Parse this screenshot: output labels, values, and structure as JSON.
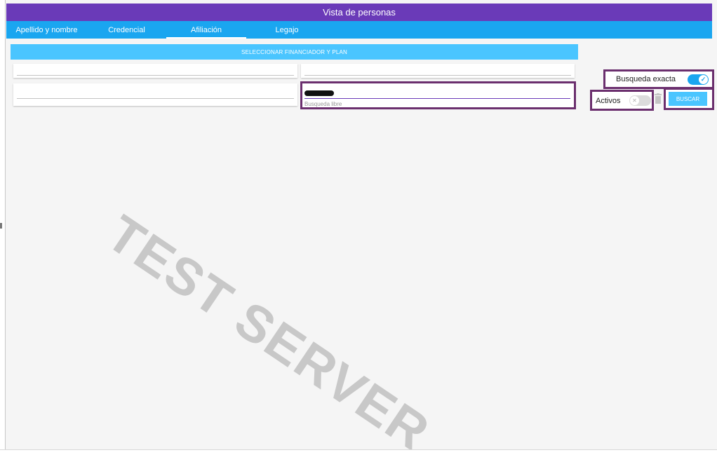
{
  "window": {
    "title": "Vista de personas"
  },
  "tabs": [
    {
      "label": "Apellido y nombre",
      "active": false
    },
    {
      "label": "Credencial",
      "active": false
    },
    {
      "label": "Afiliación",
      "active": true
    },
    {
      "label": "Legajo",
      "active": false
    }
  ],
  "form": {
    "select_plan_label": "SELECCIONAR FINANCIADOR Y PLAN",
    "field_1_value": "",
    "field_2_value": "",
    "field_3_value": "",
    "free_search": {
      "value": "[redacted]",
      "placeholder": "Busqueda libre"
    }
  },
  "controls": {
    "exact_search": {
      "label": "Busqueda exacta",
      "on": true,
      "icon": "check-icon"
    },
    "active_only": {
      "label": "Activos",
      "on": false,
      "icon": "x-icon"
    },
    "clear_icon": "trash-icon",
    "search_button_label": "BUSCAR"
  },
  "watermark": "TEST SERVER",
  "colors": {
    "title_bar": "#6a3ab8",
    "tab_bar": "#1aa6f0",
    "button": "#4ac5ff",
    "highlight_border": "#6b2f6e",
    "background": "#f5f5f5"
  }
}
